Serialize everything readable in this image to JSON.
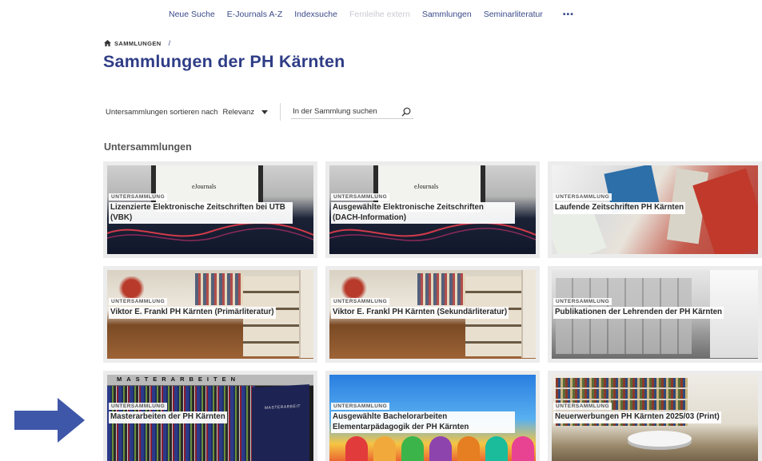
{
  "nav": {
    "items": [
      {
        "label": "Neue Suche",
        "enabled": true
      },
      {
        "label": "E-Journals A-Z",
        "enabled": true
      },
      {
        "label": "Indexsuche",
        "enabled": true
      },
      {
        "label": "Fernleihe extern",
        "enabled": false
      },
      {
        "label": "Sammlungen",
        "enabled": true
      },
      {
        "label": "Seminarliteratur",
        "enabled": true
      }
    ],
    "more_label": "•••"
  },
  "breadcrumb": {
    "home_icon": "home-icon",
    "label": "SAMMLUNGEN",
    "separator": "/"
  },
  "page": {
    "title": "Sammlungen der PH Kärnten"
  },
  "toolbar": {
    "sort_label": "Untersammlungen sortieren nach",
    "sort_value": "Relevanz",
    "search_placeholder": "In der Sammlung suchen"
  },
  "section": {
    "title": "Untersammlungen"
  },
  "tiles": [
    {
      "badge": "UNTERSAMMLUNG",
      "label": "Lizenzierte Elektronische Zeitschriften bei UTB (VBK)",
      "image_text": "eJournals"
    },
    {
      "badge": "UNTERSAMMLUNG",
      "label": "Ausgewählte Elektronische Zeitschriften (DACH-Information)",
      "image_text": "eJournals"
    },
    {
      "badge": "UNTERSAMMLUNG",
      "label": "Laufende Zeitschriften PH Kärnten"
    },
    {
      "badge": "UNTERSAMMLUNG",
      "label": "Viktor E. Frankl PH Kärnten (Primärliteratur)"
    },
    {
      "badge": "UNTERSAMMLUNG",
      "label": "Viktor E. Frankl PH Kärnten (Sekundärliteratur)"
    },
    {
      "badge": "UNTERSAMMLUNG",
      "label": "Publikationen der Lehrenden der PH Kärnten"
    },
    {
      "badge": "UNTERSAMMLUNG",
      "label": "Masterarbeiten der PH Kärnten",
      "image_text": "MASTERARBEITEN",
      "cover_text": "MASTERARBEIT"
    },
    {
      "badge": "UNTERSAMMLUNG",
      "label": "Ausgewählte Bachelorarbeiten Elementarpädagogik der PH Kärnten"
    },
    {
      "badge": "UNTERSAMMLUNG",
      "label": "Neuerwerbungen PH Kärnten 2025/03 (Print)"
    }
  ],
  "colors": {
    "accent": "#2f3d86",
    "arrow": "#3f57a8"
  }
}
